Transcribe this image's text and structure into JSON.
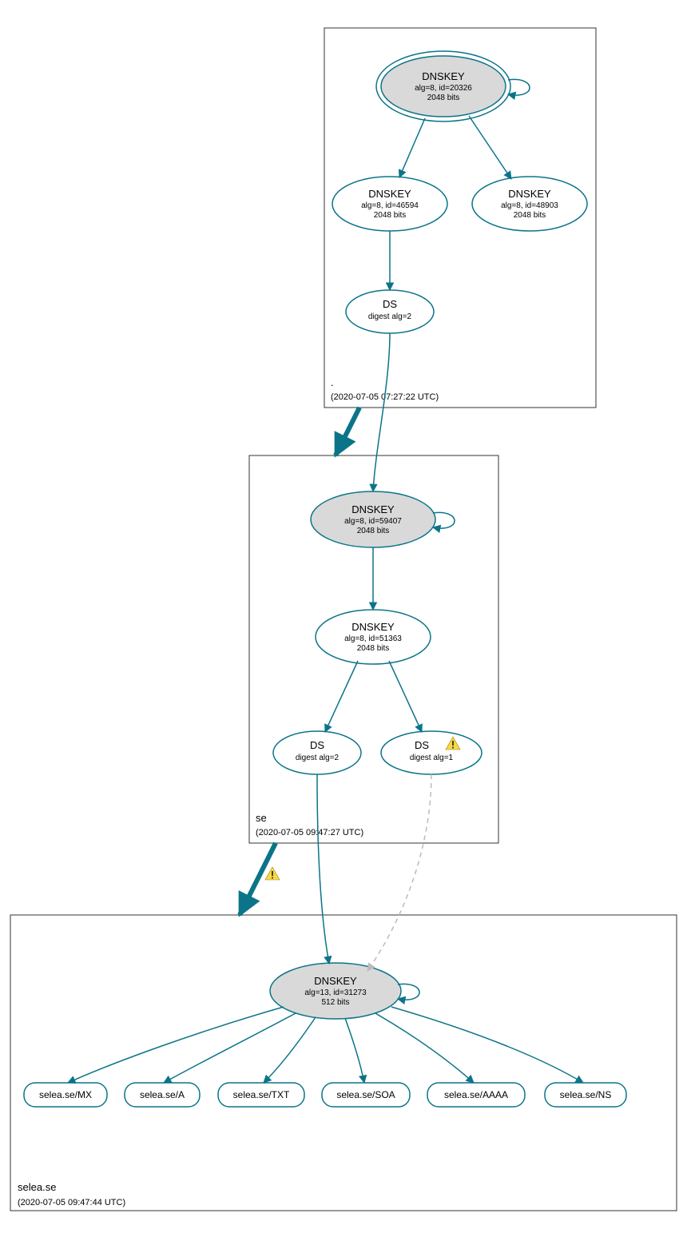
{
  "colors": {
    "teal": "#0b7489",
    "gray_fill": "#d9d9d9",
    "light_dash": "#bbbbbb",
    "warn_tri": "#f7d84b",
    "warn_bang": "#4a3e00"
  },
  "zones": {
    "root": {
      "name": ".",
      "timestamp": "(2020-07-05 07:27:22 UTC)"
    },
    "se": {
      "name": "se",
      "timestamp": "(2020-07-05 09:47:27 UTC)"
    },
    "leaf": {
      "name": "selea.se",
      "timestamp": "(2020-07-05 09:47:44 UTC)"
    }
  },
  "nodes": {
    "root_ksk": {
      "title": "DNSKEY",
      "l2": "alg=8, id=20326",
      "l3": "2048 bits"
    },
    "root_zsk1": {
      "title": "DNSKEY",
      "l2": "alg=8, id=46594",
      "l3": "2048 bits"
    },
    "root_zsk2": {
      "title": "DNSKEY",
      "l2": "alg=8, id=48903",
      "l3": "2048 bits"
    },
    "root_ds": {
      "title": "DS",
      "l2": "digest alg=2"
    },
    "se_ksk": {
      "title": "DNSKEY",
      "l2": "alg=8, id=59407",
      "l3": "2048 bits"
    },
    "se_zsk": {
      "title": "DNSKEY",
      "l2": "alg=8, id=51363",
      "l3": "2048 bits"
    },
    "se_ds2": {
      "title": "DS",
      "l2": "digest alg=2"
    },
    "se_ds1": {
      "title": "DS",
      "l2": "digest alg=1"
    },
    "leaf_ksk": {
      "title": "DNSKEY",
      "l2": "alg=13, id=31273",
      "l3": "512 bits"
    }
  },
  "rrsets": {
    "r1": "selea.se/MX",
    "r2": "selea.se/A",
    "r3": "selea.se/TXT",
    "r4": "selea.se/SOA",
    "r5": "selea.se/AAAA",
    "r6": "selea.se/NS"
  }
}
